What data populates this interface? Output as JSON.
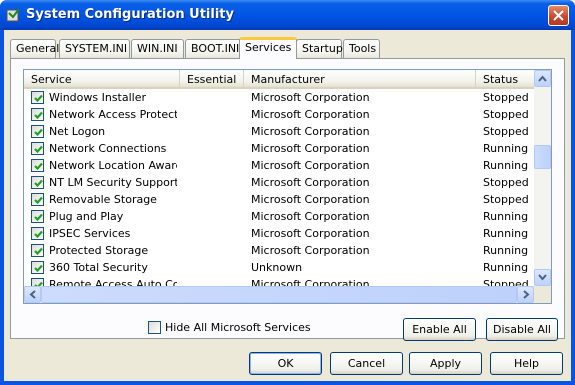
{
  "window": {
    "title": "System Configuration Utility",
    "icon": "msconfig-icon"
  },
  "tabs": [
    {
      "label": "General",
      "active": false
    },
    {
      "label": "SYSTEM.INI",
      "active": false
    },
    {
      "label": "WIN.INI",
      "active": false
    },
    {
      "label": "BOOT.INI",
      "active": false
    },
    {
      "label": "Services",
      "active": true
    },
    {
      "label": "Startup",
      "active": false
    },
    {
      "label": "Tools",
      "active": false
    }
  ],
  "list": {
    "columns": [
      "Service",
      "Essential",
      "Manufacturer",
      "Status"
    ],
    "rows": [
      {
        "checked": true,
        "service": "Windows Installer",
        "essential": "",
        "manufacturer": "Microsoft Corporation",
        "status": "Stopped"
      },
      {
        "checked": true,
        "service": "Network Access Protecti...",
        "essential": "",
        "manufacturer": "Microsoft Corporation",
        "status": "Stopped"
      },
      {
        "checked": true,
        "service": "Net Logon",
        "essential": "",
        "manufacturer": "Microsoft Corporation",
        "status": "Stopped"
      },
      {
        "checked": true,
        "service": "Network Connections",
        "essential": "",
        "manufacturer": "Microsoft Corporation",
        "status": "Running"
      },
      {
        "checked": true,
        "service": "Network Location Aware...",
        "essential": "",
        "manufacturer": "Microsoft Corporation",
        "status": "Running"
      },
      {
        "checked": true,
        "service": "NT LM Security Support ...",
        "essential": "",
        "manufacturer": "Microsoft Corporation",
        "status": "Stopped"
      },
      {
        "checked": true,
        "service": "Removable Storage",
        "essential": "",
        "manufacturer": "Microsoft Corporation",
        "status": "Stopped"
      },
      {
        "checked": true,
        "service": "Plug and Play",
        "essential": "",
        "manufacturer": "Microsoft Corporation",
        "status": "Running"
      },
      {
        "checked": true,
        "service": "IPSEC Services",
        "essential": "",
        "manufacturer": "Microsoft Corporation",
        "status": "Running"
      },
      {
        "checked": true,
        "service": "Protected Storage",
        "essential": "",
        "manufacturer": "Microsoft Corporation",
        "status": "Running"
      },
      {
        "checked": true,
        "service": "360 Total Security",
        "essential": "",
        "manufacturer": "Unknown",
        "status": "Running"
      },
      {
        "checked": true,
        "service": "Remote Access Auto Co...",
        "essential": "",
        "manufacturer": "Microsoft Corporation",
        "status": "Stopped"
      }
    ]
  },
  "options": {
    "hide_ms_label": "Hide All Microsoft Services",
    "hide_ms_checked": false,
    "enable_all": "Enable All",
    "disable_all": "Disable All"
  },
  "footer": {
    "ok": "OK",
    "cancel": "Cancel",
    "apply": "Apply",
    "help": "Help"
  },
  "colors": {
    "title_bar": "#0055e5",
    "check": "#21a121",
    "active_tab_accent": "#ffc83c"
  }
}
